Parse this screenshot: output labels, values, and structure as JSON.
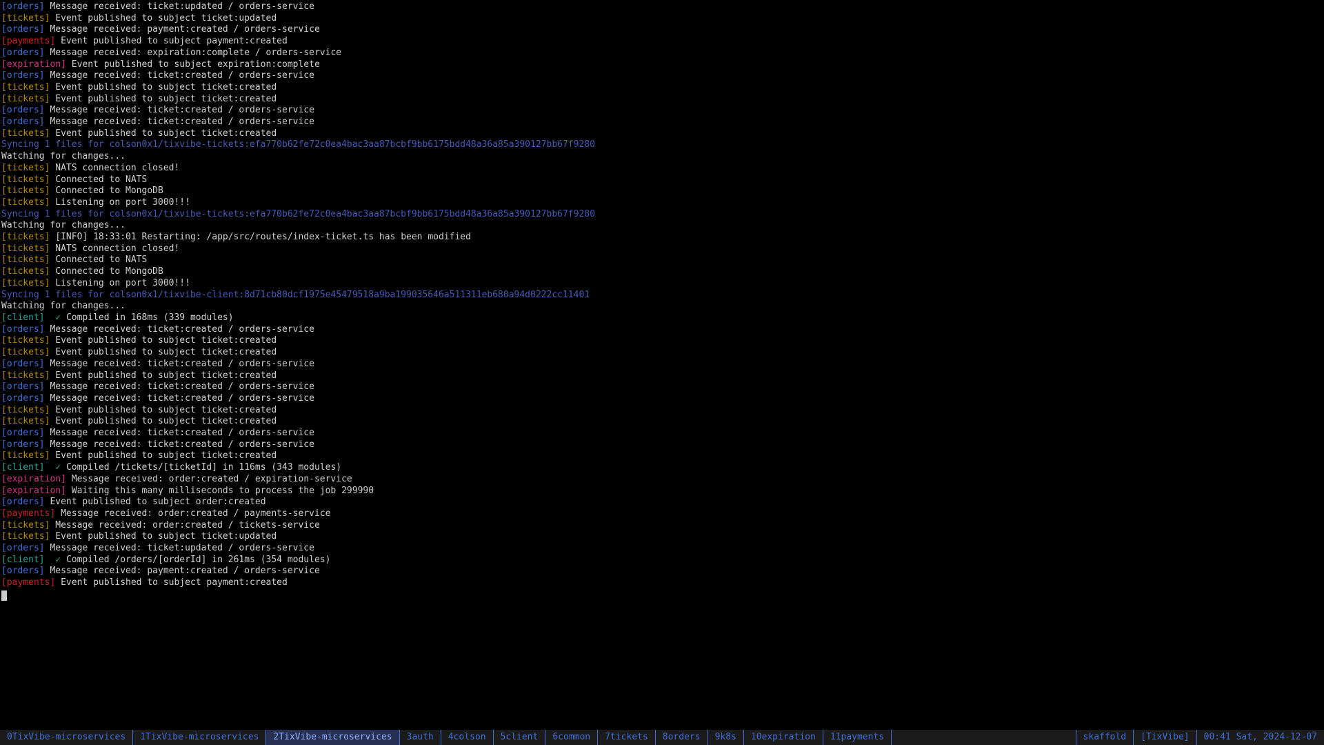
{
  "terminal": {
    "lines": [
      {
        "tag": "orders",
        "text": "Message received: ticket:updated / orders-service"
      },
      {
        "tag": "tickets",
        "text": "Event published to subject ticket:updated"
      },
      {
        "tag": "orders",
        "text": "Message received: payment:created / orders-service"
      },
      {
        "tag": "payments",
        "text": "Event published to subject payment:created"
      },
      {
        "tag": "orders",
        "text": "Message received: expiration:complete / orders-service"
      },
      {
        "tag": "expiration",
        "text": "Event published to subject expiration:complete"
      },
      {
        "tag": "orders",
        "text": "Message received: ticket:created / orders-service"
      },
      {
        "tag": "tickets",
        "text": "Event published to subject ticket:created"
      },
      {
        "tag": "tickets",
        "text": "Event published to subject ticket:created"
      },
      {
        "tag": "orders",
        "text": "Message received: ticket:created / orders-service"
      },
      {
        "tag": "orders",
        "text": "Message received: ticket:created / orders-service"
      },
      {
        "tag": "tickets",
        "text": "Event published to subject ticket:created"
      },
      {
        "type": "sync",
        "text": "Syncing 1 files for colson0x1/tixvibe-tickets:efa770b62fe72c0ea4bac3aa87bcbf9bb6175bdd48a36a85a390127bb67f9280"
      },
      {
        "type": "watch",
        "text": "Watching for changes..."
      },
      {
        "tag": "tickets",
        "text": "NATS connection closed!"
      },
      {
        "tag": "tickets",
        "text": "Connected to NATS"
      },
      {
        "tag": "tickets",
        "text": "Connected to MongoDB"
      },
      {
        "tag": "tickets",
        "text": "Listening on port 3000!!!"
      },
      {
        "type": "sync",
        "text": "Syncing 1 files for colson0x1/tixvibe-tickets:efa770b62fe72c0ea4bac3aa87bcbf9bb6175bdd48a36a85a390127bb67f9280"
      },
      {
        "type": "watch",
        "text": "Watching for changes..."
      },
      {
        "tag": "tickets",
        "text": "[INFO] 18:33:01 Restarting: /app/src/routes/index-ticket.ts has been modified"
      },
      {
        "tag": "tickets",
        "text": "NATS connection closed!"
      },
      {
        "tag": "tickets",
        "text": "Connected to NATS"
      },
      {
        "tag": "tickets",
        "text": "Connected to MongoDB"
      },
      {
        "tag": "tickets",
        "text": "Listening on port 3000!!!"
      },
      {
        "type": "sync",
        "text": "Syncing 1 files for colson0x1/tixvibe-client:8d71cb80dcf1975e45479518a9ba199035646a511311eb680a94d0222cc11401"
      },
      {
        "type": "watch",
        "text": "Watching for changes..."
      },
      {
        "tag": "client",
        "check": true,
        "text": "Compiled in 168ms (339 modules)"
      },
      {
        "tag": "orders",
        "text": "Message received: ticket:created / orders-service"
      },
      {
        "tag": "tickets",
        "text": "Event published to subject ticket:created"
      },
      {
        "tag": "tickets",
        "text": "Event published to subject ticket:created"
      },
      {
        "tag": "orders",
        "text": "Message received: ticket:created / orders-service"
      },
      {
        "tag": "tickets",
        "text": "Event published to subject ticket:created"
      },
      {
        "tag": "orders",
        "text": "Message received: ticket:created / orders-service"
      },
      {
        "tag": "orders",
        "text": "Message received: ticket:created / orders-service"
      },
      {
        "tag": "tickets",
        "text": "Event published to subject ticket:created"
      },
      {
        "tag": "tickets",
        "text": "Event published to subject ticket:created"
      },
      {
        "tag": "orders",
        "text": "Message received: ticket:created / orders-service"
      },
      {
        "tag": "orders",
        "text": "Message received: ticket:created / orders-service"
      },
      {
        "tag": "tickets",
        "text": "Event published to subject ticket:created"
      },
      {
        "tag": "client",
        "check": true,
        "text": "Compiled /tickets/[ticketId] in 116ms (343 modules)"
      },
      {
        "tag": "expiration",
        "text": "Message received: order:created / expiration-service"
      },
      {
        "tag": "expiration",
        "text": "Waiting this many milliseconds to process the job 299990"
      },
      {
        "tag": "orders",
        "text": "Event published to subject order:created"
      },
      {
        "tag": "payments",
        "text": "Message received: order:created / payments-service"
      },
      {
        "tag": "tickets",
        "text": "Message received: order:created / tickets-service"
      },
      {
        "tag": "tickets",
        "text": "Event published to subject ticket:updated"
      },
      {
        "tag": "orders",
        "text": "Message received: ticket:updated / orders-service"
      },
      {
        "tag": "client",
        "check": true,
        "text": "Compiled /orders/[orderId] in 261ms (354 modules)"
      },
      {
        "tag": "orders",
        "text": "Message received: payment:created / orders-service"
      },
      {
        "tag": "payments",
        "text": "Event published to subject payment:created"
      }
    ]
  },
  "status": {
    "tabs": [
      {
        "index": "0",
        "label": "TixVibe-microservices",
        "active": false
      },
      {
        "index": "1",
        "label": "TixVibe-microservices",
        "active": false
      },
      {
        "index": "2",
        "label": "TixVibe-microservices",
        "active": true
      },
      {
        "index": "3",
        "label": "auth",
        "active": false
      },
      {
        "index": "4",
        "label": "colson",
        "active": false
      },
      {
        "index": "5",
        "label": "client",
        "active": false
      },
      {
        "index": "6",
        "label": "common",
        "active": false
      },
      {
        "index": "7",
        "label": "tickets",
        "active": false
      },
      {
        "index": "8",
        "label": "orders",
        "active": false
      },
      {
        "index": "9",
        "label": "k8s",
        "active": false
      },
      {
        "index": "10",
        "label": "expiration",
        "active": false
      },
      {
        "index": "11",
        "label": "payments",
        "active": false
      }
    ],
    "right": {
      "process": "skaffold",
      "session": "[TixVibe]",
      "clock": "00:41 Sat, 2024-12-07"
    }
  }
}
